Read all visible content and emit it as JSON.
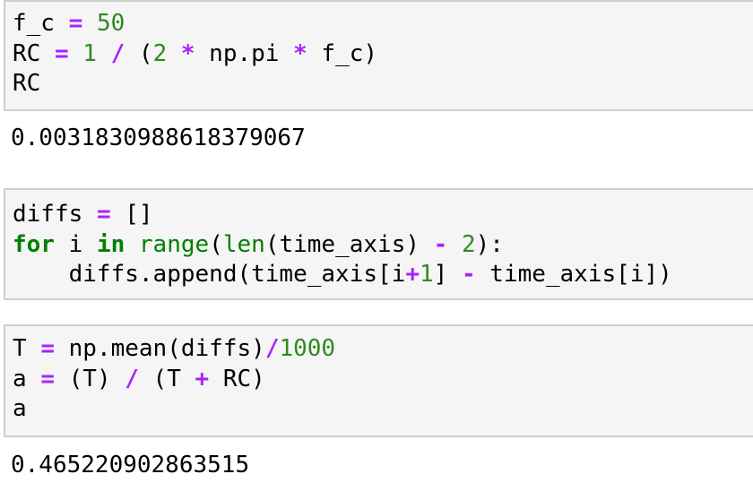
{
  "cells": [
    {
      "id": "cell-1",
      "lines": [
        [
          {
            "t": "f_c",
            "c": "id"
          },
          {
            "t": " ",
            "c": "pn"
          },
          {
            "t": "=",
            "c": "op"
          },
          {
            "t": " ",
            "c": "pn"
          },
          {
            "t": "50",
            "c": "num"
          }
        ],
        [
          {
            "t": "RC",
            "c": "id"
          },
          {
            "t": " ",
            "c": "pn"
          },
          {
            "t": "=",
            "c": "op"
          },
          {
            "t": " ",
            "c": "pn"
          },
          {
            "t": "1",
            "c": "num"
          },
          {
            "t": " ",
            "c": "pn"
          },
          {
            "t": "/",
            "c": "op"
          },
          {
            "t": " (",
            "c": "pn"
          },
          {
            "t": "2",
            "c": "num"
          },
          {
            "t": " ",
            "c": "pn"
          },
          {
            "t": "*",
            "c": "op"
          },
          {
            "t": " np",
            "c": "id"
          },
          {
            "t": ".",
            "c": "pn"
          },
          {
            "t": "pi",
            "c": "id"
          },
          {
            "t": " ",
            "c": "pn"
          },
          {
            "t": "*",
            "c": "op"
          },
          {
            "t": " f_c",
            "c": "id"
          },
          {
            "t": ")",
            "c": "pn"
          }
        ],
        [
          {
            "t": "RC",
            "c": "id"
          }
        ]
      ],
      "output": "0.0031830988618379067"
    },
    {
      "id": "cell-2",
      "lines": [
        [
          {
            "t": "diffs",
            "c": "id"
          },
          {
            "t": " ",
            "c": "pn"
          },
          {
            "t": "=",
            "c": "op"
          },
          {
            "t": " []",
            "c": "pn"
          }
        ],
        [
          {
            "t": "for",
            "c": "kw"
          },
          {
            "t": " i ",
            "c": "id"
          },
          {
            "t": "in",
            "c": "kw"
          },
          {
            "t": " ",
            "c": "pn"
          },
          {
            "t": "range",
            "c": "bi"
          },
          {
            "t": "(",
            "c": "pn"
          },
          {
            "t": "len",
            "c": "bi"
          },
          {
            "t": "(",
            "c": "pn"
          },
          {
            "t": "time_axis",
            "c": "id"
          },
          {
            "t": ") ",
            "c": "pn"
          },
          {
            "t": "-",
            "c": "op"
          },
          {
            "t": " ",
            "c": "pn"
          },
          {
            "t": "2",
            "c": "num"
          },
          {
            "t": "):",
            "c": "pn"
          }
        ],
        [
          {
            "t": "    diffs",
            "c": "id"
          },
          {
            "t": ".",
            "c": "pn"
          },
          {
            "t": "append",
            "c": "id"
          },
          {
            "t": "(",
            "c": "pn"
          },
          {
            "t": "time_axis",
            "c": "id"
          },
          {
            "t": "[",
            "c": "pn"
          },
          {
            "t": "i",
            "c": "id"
          },
          {
            "t": "+",
            "c": "op"
          },
          {
            "t": "1",
            "c": "num"
          },
          {
            "t": "] ",
            "c": "pn"
          },
          {
            "t": "-",
            "c": "op"
          },
          {
            "t": " time_axis",
            "c": "id"
          },
          {
            "t": "[",
            "c": "pn"
          },
          {
            "t": "i",
            "c": "id"
          },
          {
            "t": "])",
            "c": "pn"
          }
        ]
      ],
      "output": null
    },
    {
      "id": "cell-3",
      "lines": [
        [
          {
            "t": "T",
            "c": "id"
          },
          {
            "t": " ",
            "c": "pn"
          },
          {
            "t": "=",
            "c": "op"
          },
          {
            "t": " np",
            "c": "id"
          },
          {
            "t": ".",
            "c": "pn"
          },
          {
            "t": "mean",
            "c": "id"
          },
          {
            "t": "(",
            "c": "pn"
          },
          {
            "t": "diffs",
            "c": "id"
          },
          {
            "t": ")",
            "c": "pn"
          },
          {
            "t": "/",
            "c": "op"
          },
          {
            "t": "1000",
            "c": "num"
          }
        ],
        [
          {
            "t": "a",
            "c": "id"
          },
          {
            "t": " ",
            "c": "pn"
          },
          {
            "t": "=",
            "c": "op"
          },
          {
            "t": " (",
            "c": "pn"
          },
          {
            "t": "T",
            "c": "id"
          },
          {
            "t": ") ",
            "c": "pn"
          },
          {
            "t": "/",
            "c": "op"
          },
          {
            "t": " (",
            "c": "pn"
          },
          {
            "t": "T",
            "c": "id"
          },
          {
            "t": " ",
            "c": "pn"
          },
          {
            "t": "+",
            "c": "op"
          },
          {
            "t": " RC",
            "c": "id"
          },
          {
            "t": ")",
            "c": "pn"
          }
        ],
        [
          {
            "t": "a",
            "c": "id"
          }
        ]
      ],
      "output": "0.465220902863515"
    }
  ],
  "colors": {
    "operator": "#aa22ff",
    "number": "#2e8b1f",
    "keyword": "#008000",
    "builtin": "#008000",
    "cell_background": "#f5f5f5",
    "cell_border": "#cfcfcf"
  }
}
